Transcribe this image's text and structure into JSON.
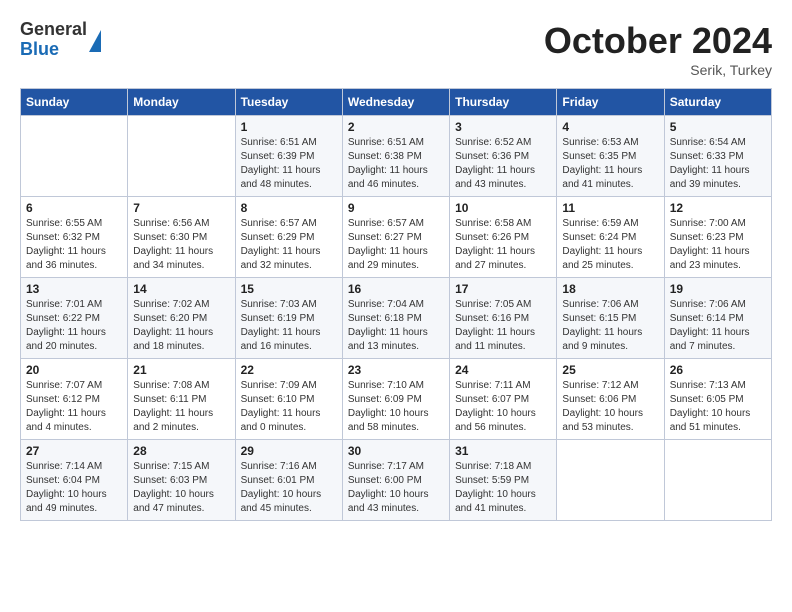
{
  "header": {
    "logo": {
      "general": "General",
      "blue": "Blue"
    },
    "title": "October 2024",
    "location": "Serik, Turkey"
  },
  "weekdays": [
    "Sunday",
    "Monday",
    "Tuesday",
    "Wednesday",
    "Thursday",
    "Friday",
    "Saturday"
  ],
  "weeks": [
    [
      {
        "day": null,
        "info": null
      },
      {
        "day": null,
        "info": null
      },
      {
        "day": "1",
        "info": "Sunrise: 6:51 AM\nSunset: 6:39 PM\nDaylight: 11 hours and 48 minutes."
      },
      {
        "day": "2",
        "info": "Sunrise: 6:51 AM\nSunset: 6:38 PM\nDaylight: 11 hours and 46 minutes."
      },
      {
        "day": "3",
        "info": "Sunrise: 6:52 AM\nSunset: 6:36 PM\nDaylight: 11 hours and 43 minutes."
      },
      {
        "day": "4",
        "info": "Sunrise: 6:53 AM\nSunset: 6:35 PM\nDaylight: 11 hours and 41 minutes."
      },
      {
        "day": "5",
        "info": "Sunrise: 6:54 AM\nSunset: 6:33 PM\nDaylight: 11 hours and 39 minutes."
      }
    ],
    [
      {
        "day": "6",
        "info": "Sunrise: 6:55 AM\nSunset: 6:32 PM\nDaylight: 11 hours and 36 minutes."
      },
      {
        "day": "7",
        "info": "Sunrise: 6:56 AM\nSunset: 6:30 PM\nDaylight: 11 hours and 34 minutes."
      },
      {
        "day": "8",
        "info": "Sunrise: 6:57 AM\nSunset: 6:29 PM\nDaylight: 11 hours and 32 minutes."
      },
      {
        "day": "9",
        "info": "Sunrise: 6:57 AM\nSunset: 6:27 PM\nDaylight: 11 hours and 29 minutes."
      },
      {
        "day": "10",
        "info": "Sunrise: 6:58 AM\nSunset: 6:26 PM\nDaylight: 11 hours and 27 minutes."
      },
      {
        "day": "11",
        "info": "Sunrise: 6:59 AM\nSunset: 6:24 PM\nDaylight: 11 hours and 25 minutes."
      },
      {
        "day": "12",
        "info": "Sunrise: 7:00 AM\nSunset: 6:23 PM\nDaylight: 11 hours and 23 minutes."
      }
    ],
    [
      {
        "day": "13",
        "info": "Sunrise: 7:01 AM\nSunset: 6:22 PM\nDaylight: 11 hours and 20 minutes."
      },
      {
        "day": "14",
        "info": "Sunrise: 7:02 AM\nSunset: 6:20 PM\nDaylight: 11 hours and 18 minutes."
      },
      {
        "day": "15",
        "info": "Sunrise: 7:03 AM\nSunset: 6:19 PM\nDaylight: 11 hours and 16 minutes."
      },
      {
        "day": "16",
        "info": "Sunrise: 7:04 AM\nSunset: 6:18 PM\nDaylight: 11 hours and 13 minutes."
      },
      {
        "day": "17",
        "info": "Sunrise: 7:05 AM\nSunset: 6:16 PM\nDaylight: 11 hours and 11 minutes."
      },
      {
        "day": "18",
        "info": "Sunrise: 7:06 AM\nSunset: 6:15 PM\nDaylight: 11 hours and 9 minutes."
      },
      {
        "day": "19",
        "info": "Sunrise: 7:06 AM\nSunset: 6:14 PM\nDaylight: 11 hours and 7 minutes."
      }
    ],
    [
      {
        "day": "20",
        "info": "Sunrise: 7:07 AM\nSunset: 6:12 PM\nDaylight: 11 hours and 4 minutes."
      },
      {
        "day": "21",
        "info": "Sunrise: 7:08 AM\nSunset: 6:11 PM\nDaylight: 11 hours and 2 minutes."
      },
      {
        "day": "22",
        "info": "Sunrise: 7:09 AM\nSunset: 6:10 PM\nDaylight: 11 hours and 0 minutes."
      },
      {
        "day": "23",
        "info": "Sunrise: 7:10 AM\nSunset: 6:09 PM\nDaylight: 10 hours and 58 minutes."
      },
      {
        "day": "24",
        "info": "Sunrise: 7:11 AM\nSunset: 6:07 PM\nDaylight: 10 hours and 56 minutes."
      },
      {
        "day": "25",
        "info": "Sunrise: 7:12 AM\nSunset: 6:06 PM\nDaylight: 10 hours and 53 minutes."
      },
      {
        "day": "26",
        "info": "Sunrise: 7:13 AM\nSunset: 6:05 PM\nDaylight: 10 hours and 51 minutes."
      }
    ],
    [
      {
        "day": "27",
        "info": "Sunrise: 7:14 AM\nSunset: 6:04 PM\nDaylight: 10 hours and 49 minutes."
      },
      {
        "day": "28",
        "info": "Sunrise: 7:15 AM\nSunset: 6:03 PM\nDaylight: 10 hours and 47 minutes."
      },
      {
        "day": "29",
        "info": "Sunrise: 7:16 AM\nSunset: 6:01 PM\nDaylight: 10 hours and 45 minutes."
      },
      {
        "day": "30",
        "info": "Sunrise: 7:17 AM\nSunset: 6:00 PM\nDaylight: 10 hours and 43 minutes."
      },
      {
        "day": "31",
        "info": "Sunrise: 7:18 AM\nSunset: 5:59 PM\nDaylight: 10 hours and 41 minutes."
      },
      {
        "day": null,
        "info": null
      },
      {
        "day": null,
        "info": null
      }
    ]
  ]
}
